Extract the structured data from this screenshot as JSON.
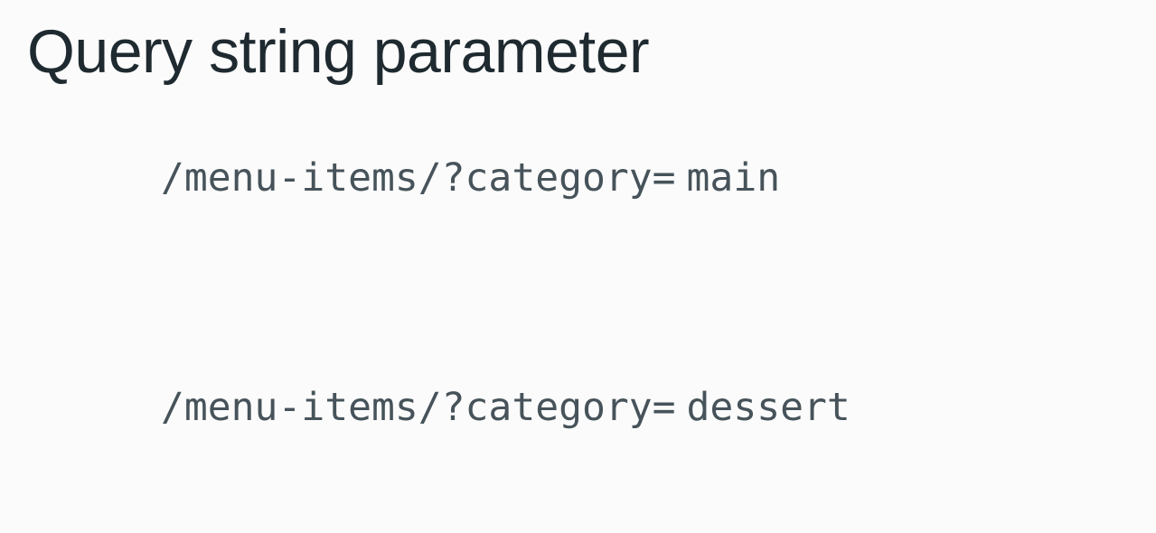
{
  "slide": {
    "title": "Query string parameter",
    "examples": [
      {
        "path": "/menu-items/?category=",
        "value": "main"
      },
      {
        "path": "/menu-items/?category=",
        "value": "dessert"
      }
    ]
  }
}
